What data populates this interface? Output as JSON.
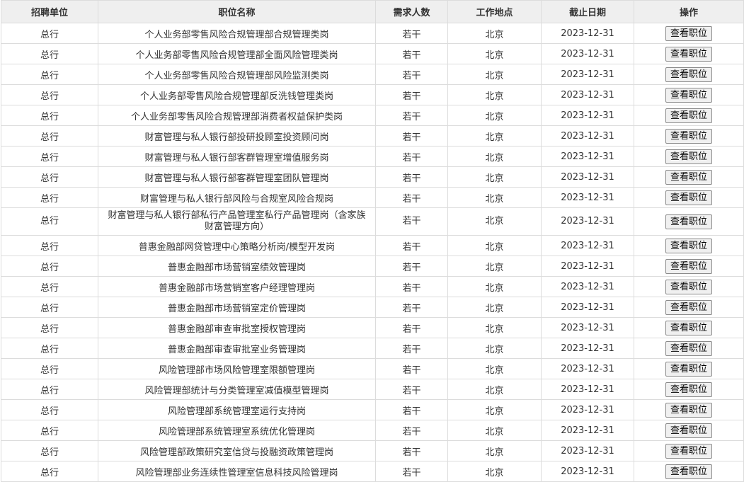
{
  "headers": [
    "招聘单位",
    "职位名称",
    "需求人数",
    "工作地点",
    "截止日期",
    "操作"
  ],
  "rows": [
    {
      "unit": "总行",
      "title": "个人业务部零售风险合规管理部合规管理类岗",
      "count": "若干",
      "location": "北京",
      "deadline": "2023-12-31",
      "action": "查看职位"
    },
    {
      "unit": "总行",
      "title": "个人业务部零售风险合规管理部全面风险管理类岗",
      "count": "若干",
      "location": "北京",
      "deadline": "2023-12-31",
      "action": "查看职位"
    },
    {
      "unit": "总行",
      "title": "个人业务部零售风险合规管理部风险监测类岗",
      "count": "若干",
      "location": "北京",
      "deadline": "2023-12-31",
      "action": "查看职位"
    },
    {
      "unit": "总行",
      "title": "个人业务部零售风险合规管理部反洗钱管理类岗",
      "count": "若干",
      "location": "北京",
      "deadline": "2023-12-31",
      "action": "查看职位"
    },
    {
      "unit": "总行",
      "title": "个人业务部零售风险合规管理部消费者权益保护类岗",
      "count": "若干",
      "location": "北京",
      "deadline": "2023-12-31",
      "action": "查看职位"
    },
    {
      "unit": "总行",
      "title": "财富管理与私人银行部投研投顾室投资顾问岗",
      "count": "若干",
      "location": "北京",
      "deadline": "2023-12-31",
      "action": "查看职位"
    },
    {
      "unit": "总行",
      "title": "财富管理与私人银行部客群管理室增值服务岗",
      "count": "若干",
      "location": "北京",
      "deadline": "2023-12-31",
      "action": "查看职位"
    },
    {
      "unit": "总行",
      "title": "财富管理与私人银行部客群管理室团队管理岗",
      "count": "若干",
      "location": "北京",
      "deadline": "2023-12-31",
      "action": "查看职位"
    },
    {
      "unit": "总行",
      "title": "财富管理与私人银行部风险与合规室风险合规岗",
      "count": "若干",
      "location": "北京",
      "deadline": "2023-12-31",
      "action": "查看职位"
    },
    {
      "unit": "总行",
      "title": "财富管理与私人银行部私行产品管理室私行产品管理岗（含家族财富管理方向）",
      "count": "若干",
      "location": "北京",
      "deadline": "2023-12-31",
      "action": "查看职位",
      "tall": true
    },
    {
      "unit": "总行",
      "title": "普惠金融部网贷管理中心策略分析岗/模型开发岗",
      "count": "若干",
      "location": "北京",
      "deadline": "2023-12-31",
      "action": "查看职位"
    },
    {
      "unit": "总行",
      "title": "普惠金融部市场营销室绩效管理岗",
      "count": "若干",
      "location": "北京",
      "deadline": "2023-12-31",
      "action": "查看职位"
    },
    {
      "unit": "总行",
      "title": "普惠金融部市场营销室客户经理管理岗",
      "count": "若干",
      "location": "北京",
      "deadline": "2023-12-31",
      "action": "查看职位"
    },
    {
      "unit": "总行",
      "title": "普惠金融部市场营销室定价管理岗",
      "count": "若干",
      "location": "北京",
      "deadline": "2023-12-31",
      "action": "查看职位"
    },
    {
      "unit": "总行",
      "title": "普惠金融部审查审批室授权管理岗",
      "count": "若干",
      "location": "北京",
      "deadline": "2023-12-31",
      "action": "查看职位"
    },
    {
      "unit": "总行",
      "title": "普惠金融部审查审批室业务管理岗",
      "count": "若干",
      "location": "北京",
      "deadline": "2023-12-31",
      "action": "查看职位"
    },
    {
      "unit": "总行",
      "title": "风险管理部市场风险管理室限额管理岗",
      "count": "若干",
      "location": "北京",
      "deadline": "2023-12-31",
      "action": "查看职位"
    },
    {
      "unit": "总行",
      "title": "风险管理部统计与分类管理室减值模型管理岗",
      "count": "若干",
      "location": "北京",
      "deadline": "2023-12-31",
      "action": "查看职位"
    },
    {
      "unit": "总行",
      "title": "风险管理部系统管理室运行支持岗",
      "count": "若干",
      "location": "北京",
      "deadline": "2023-12-31",
      "action": "查看职位"
    },
    {
      "unit": "总行",
      "title": "风险管理部系统管理室系统优化管理岗",
      "count": "若干",
      "location": "北京",
      "deadline": "2023-12-31",
      "action": "查看职位"
    },
    {
      "unit": "总行",
      "title": "风险管理部政策研究室信贷与投融资政策管理岗",
      "count": "若干",
      "location": "北京",
      "deadline": "2023-12-31",
      "action": "查看职位"
    },
    {
      "unit": "总行",
      "title": "风险管理部业务连续性管理室信息科技风险管理岗",
      "count": "若干",
      "location": "北京",
      "deadline": "2023-12-31",
      "action": "查看职位"
    }
  ]
}
